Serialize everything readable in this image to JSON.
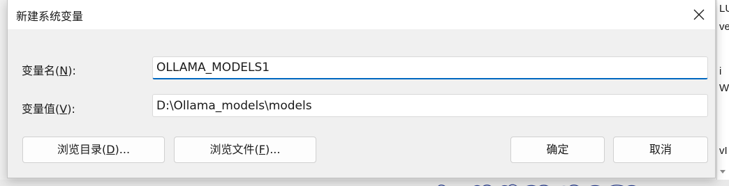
{
  "dialog": {
    "title": "新建系统变量",
    "close_icon": "close-icon"
  },
  "fields": {
    "name": {
      "label_prefix": "变量名(",
      "label_key": "N",
      "label_suffix": "):",
      "value": "OLLAMA_MODELS1"
    },
    "value": {
      "label_prefix": "变量值(",
      "label_key": "V",
      "label_suffix": "):",
      "value": "D:\\Ollama_models\\models"
    }
  },
  "buttons": {
    "browse_dir": {
      "prefix": "浏览目录(",
      "key": "D",
      "suffix": ")..."
    },
    "browse_file": {
      "prefix": "浏览文件(",
      "key": "F",
      "suffix": ")..."
    },
    "ok": "确定",
    "cancel": "取消"
  },
  "background": {
    "right_fragments": [
      "LU",
      "ve",
      "i",
      "W",
      "vI"
    ]
  },
  "colors": {
    "accent": "#0067c0",
    "dialog_bg": "#f0f0f0",
    "titlebar_bg": "#ffffff"
  }
}
